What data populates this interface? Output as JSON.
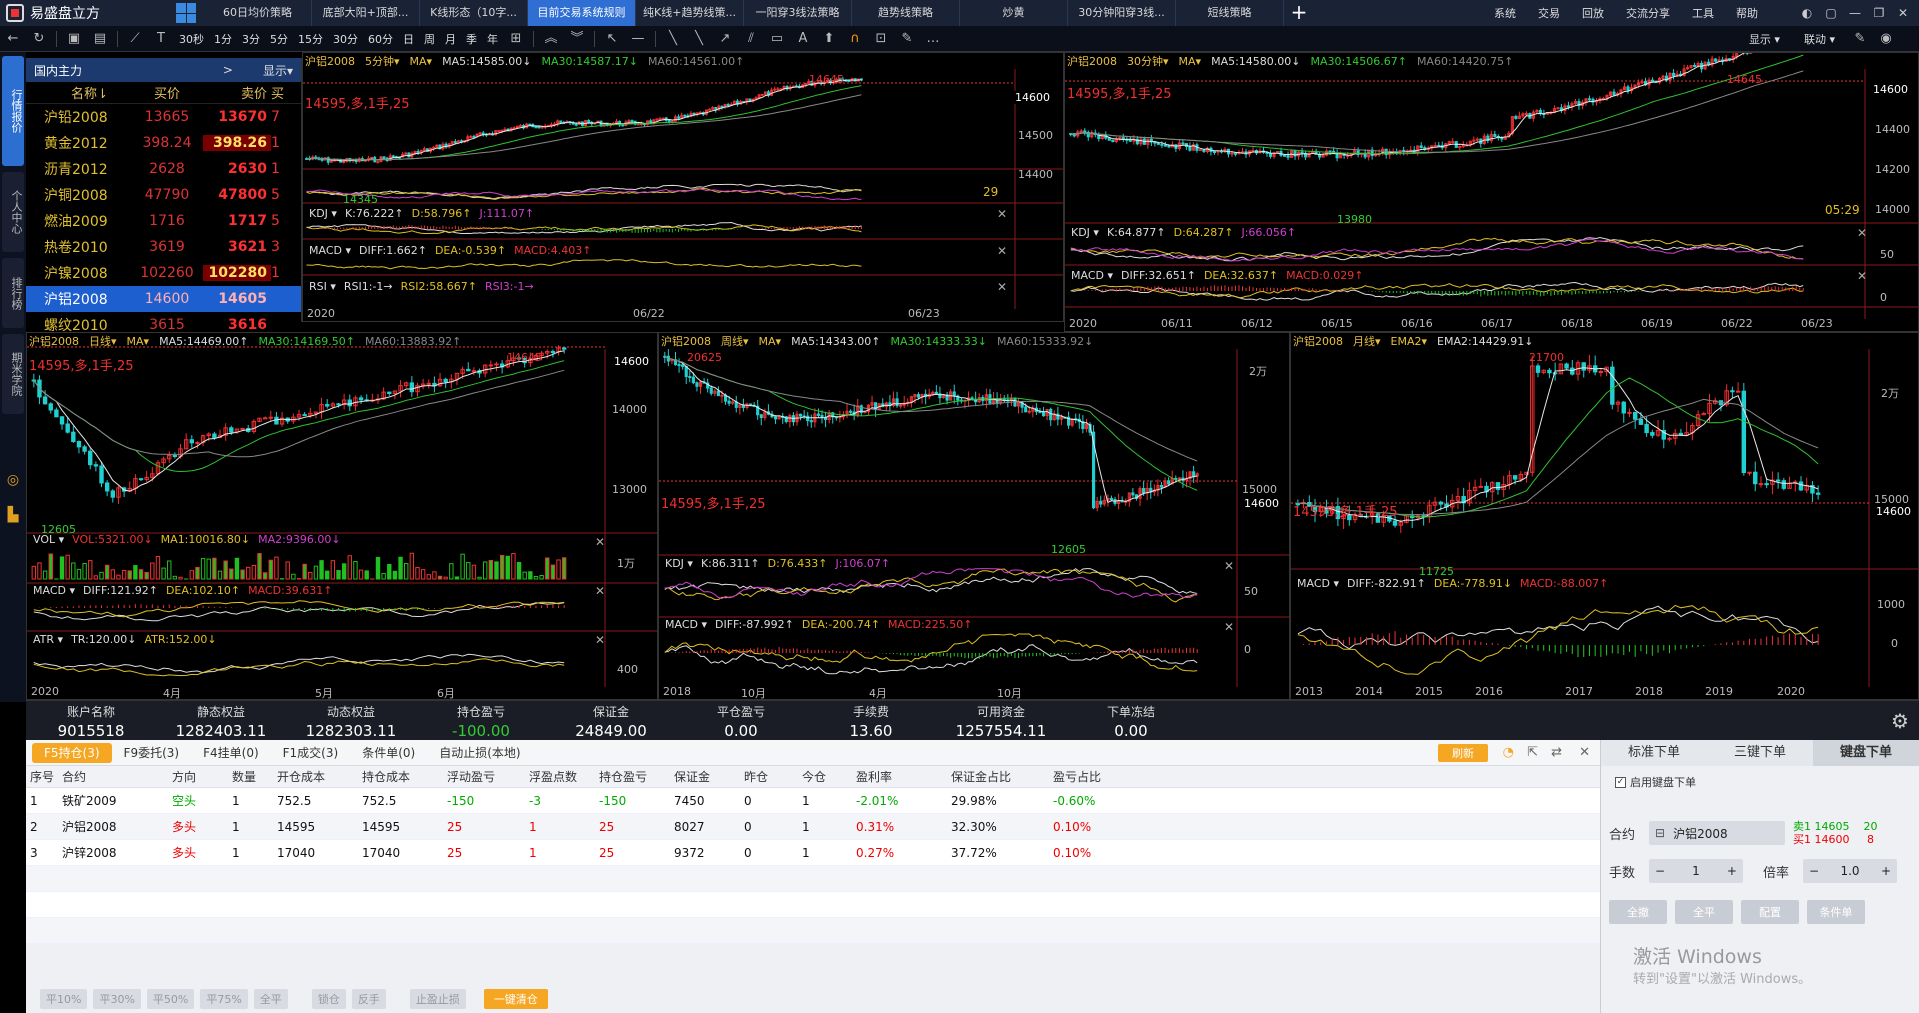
{
  "app": {
    "title": "易盛盘立方"
  },
  "strategy_tabs": [
    "60日均价策略",
    "底部大阳+顶部...",
    "K线形态（10字...",
    "目前交易系统规则",
    "纯K线+趋势线策...",
    "一阳穿3线法策略",
    "趋势线策略",
    "炒黄",
    "30分钟阳穿3线...",
    "短线策略"
  ],
  "active_strategy": 3,
  "menus": [
    "系统",
    "交易",
    "回放",
    "交流分享",
    "工具",
    "帮助"
  ],
  "toolbar": {
    "periods": [
      "30秒",
      "1分",
      "3分",
      "5分",
      "15分",
      "30分",
      "60分",
      "日",
      "周",
      "月",
      "季",
      "年"
    ],
    "display": "显示",
    "link": "联动"
  },
  "left_rail": {
    "tabs": [
      "行情报价",
      "个人中心",
      "排行榜",
      "期米学院"
    ]
  },
  "quote_panel": {
    "title": "国内主力",
    "arrow": ">",
    "display": "显示",
    "columns": {
      "name": "名称",
      "bid": "买价",
      "ask": "卖价",
      "extra": "买"
    },
    "rows": [
      {
        "name": "沪铅2008",
        "sup": "M",
        "bid": "13665",
        "ask": "13670",
        "extra": "7"
      },
      {
        "name": "黄金2012",
        "sup": "M",
        "bid": "398.24",
        "ask": "398.26",
        "extra": "1"
      },
      {
        "name": "沥青2012",
        "sup": "M",
        "bid": "2628",
        "ask": "2630",
        "extra": "1"
      },
      {
        "name": "沪铜2008",
        "sup": "M",
        "bid": "47790",
        "ask": "47800",
        "extra": "5"
      },
      {
        "name": "燃油2009",
        "sup": "M",
        "bid": "1716",
        "ask": "1717",
        "extra": "5"
      },
      {
        "name": "热卷2010",
        "sup": "M",
        "bid": "3619",
        "ask": "3621",
        "extra": "3"
      },
      {
        "name": "沪镍2008",
        "sup": "M",
        "bid": "102260",
        "ask": "102280",
        "extra": "1"
      },
      {
        "name": "沪铝2008",
        "sup": "M",
        "bid": "14600",
        "ask": "14605",
        "extra": ""
      },
      {
        "name": "螺纹2010",
        "sup": "M",
        "bid": "3615",
        "ask": "3616",
        "extra": ""
      }
    ]
  },
  "charts": {
    "c5": {
      "sym": "沪铝2008",
      "period": "5分钟",
      "ind": "MA",
      "ma5": "MA5:14585.00↓",
      "ma30": "MA30:14587.17↓",
      "ma60": "MA60:14561.00↑",
      "pos": "14595,多,1手,25",
      "high": "14645",
      "low": "14345",
      "price": "14600",
      "axis": [
        "14500",
        "14400"
      ],
      "count": "29",
      "kdj": {
        "k": "K:76.222↑",
        "d": "D:58.796↑",
        "j": "J:111.07↑"
      },
      "macd": {
        "diff": "DIFF:1.662↑",
        "dea": "DEA:-0.539↑",
        "macd": "MACD:4.403↑"
      },
      "rsi": {
        "r1": "RSI1:-1→",
        "r2": "RSI2:58.667↑",
        "r3": "RSI3:-1→"
      },
      "dates": [
        "2020",
        "06/22",
        "06/23"
      ]
    },
    "c30": {
      "sym": "沪铝2008",
      "period": "30分钟",
      "ind": "MA",
      "ma5": "MA5:14580.00↓",
      "ma30": "MA30:14506.67↑",
      "ma60": "MA60:14420.75↑",
      "pos": "14595,多,1手,25",
      "high": "14645",
      "low": "13980",
      "price": "14600",
      "axis": [
        "14400",
        "14200",
        "14000"
      ],
      "clock": "05:29",
      "kdj": {
        "k": "K:64.877↑",
        "d": "D:64.287↑",
        "j": "J:66.056↑"
      },
      "macd": {
        "diff": "DIFF:32.651↑",
        "dea": "DEA:32.637↑",
        "macd": "MACD:0.029↑"
      },
      "sub_axis": [
        "50",
        "0"
      ],
      "dates": [
        "2020",
        "06/11",
        "06/12",
        "06/15",
        "06/16",
        "06/17",
        "06/18",
        "06/19",
        "06/22",
        "06/23"
      ]
    },
    "day": {
      "sym": "沪铝2008",
      "period": "日线",
      "ind": "MA",
      "ma5": "MA5:14469.00↑",
      "ma30": "MA30:14169.50↑",
      "ma60": "MA60:13883.92↑",
      "pos": "14595,多,1手,25",
      "high": "14645",
      "low": "12605",
      "price": "14600",
      "axis": [
        "14000",
        "13000"
      ],
      "vol": {
        "vol": "VOL:5321.00↓",
        "ma1": "MA1:10016.80↓",
        "ma2": "MA2:9396.00↓"
      },
      "vol_axis": "1万",
      "macd": {
        "diff": "DIFF:121.92↑",
        "dea": "DEA:102.10↑",
        "macd": "MACD:39.631↑"
      },
      "atr": {
        "tr": "TR:120.00↓",
        "atr": "ATR:152.00↓"
      },
      "atr_axis": "400",
      "dates": [
        "2020",
        "4月",
        "5月",
        "6月"
      ]
    },
    "week": {
      "sym": "沪铝2008",
      "period": "周线",
      "ind": "MA",
      "ma5": "MA5:14343.00↑",
      "ma30": "MA30:14333.33↓",
      "ma60": "MA60:15333.92↓",
      "pos": "14595,多,1手,25",
      "high": "20625",
      "low": "12605",
      "price": "14600",
      "axis": [
        "2万",
        "15000"
      ],
      "kdj": {
        "k": "K:86.311↑",
        "d": "D:76.433↑",
        "j": "J:106.07↑"
      },
      "kdj_axis": "50",
      "macd": {
        "diff": "DIFF:-87.992↑",
        "dea": "DEA:-200.74↑",
        "macd": "MACD:225.50↑"
      },
      "macd_axis": "0",
      "dates": [
        "2018",
        "10月",
        "4月",
        "10月"
      ]
    },
    "month": {
      "sym": "沪铝2008",
      "period": "月线",
      "ind": "EMA2",
      "ema": "EMA2:14429.91↓",
      "pos": "14595,多,1手,25",
      "high": "21700",
      "low": "11725",
      "price": "14600",
      "axis": [
        "2万",
        "15000"
      ],
      "macd": {
        "diff": "DIFF:-822.91↑",
        "dea": "DEA:-778.91↓",
        "macd": "MACD:-88.007↑"
      },
      "macd_axis": [
        "1000",
        "0"
      ],
      "dates": [
        "2013",
        "2014",
        "2015",
        "2016",
        "2017",
        "2018",
        "2019",
        "2020"
      ]
    }
  },
  "account": [
    {
      "label": "账户名称",
      "value": "9015518"
    },
    {
      "label": "静态权益",
      "value": "1282403.11"
    },
    {
      "label": "动态权益",
      "value": "1282303.11"
    },
    {
      "label": "持仓盈亏",
      "value": "-100.00"
    },
    {
      "label": "保证金",
      "value": "24849.00"
    },
    {
      "label": "平仓盈亏",
      "value": "0.00"
    },
    {
      "label": "手续费",
      "value": "13.60"
    },
    {
      "label": "可用资金",
      "value": "1257554.11"
    },
    {
      "label": "下单冻结",
      "value": "0.00"
    }
  ],
  "positions": {
    "tabs": [
      "F5持仓(3)",
      "F9委托(3)",
      "F4挂单(0)",
      "F1成交(3)",
      "条件单(0)",
      "自动止损(本地)"
    ],
    "refresh": "刷新",
    "columns": [
      "序号",
      "合约",
      "方向",
      "数量",
      "开仓成本",
      "持仓成本",
      "浮动盈亏",
      "浮盈点数",
      "持仓盈亏",
      "保证金",
      "昨仓",
      "今仓",
      "盈利率",
      "保证金占比",
      "盈亏占比"
    ],
    "rows": [
      [
        "1",
        "铁矿2009",
        "空头",
        "1",
        "752.5",
        "752.5",
        "-150",
        "-3",
        "-150",
        "7450",
        "0",
        "1",
        "-2.01%",
        "29.98%",
        "-0.60%"
      ],
      [
        "2",
        "沪铝2008",
        "多头",
        "1",
        "14595",
        "14595",
        "25",
        "1",
        "25",
        "8027",
        "0",
        "1",
        "0.31%",
        "32.30%",
        "0.10%"
      ],
      [
        "3",
        "沪锌2008",
        "多头",
        "1",
        "17040",
        "17040",
        "25",
        "1",
        "25",
        "9372",
        "0",
        "1",
        "0.27%",
        "37.72%",
        "0.10%"
      ]
    ],
    "buttons": [
      "平10%",
      "平30%",
      "平50%",
      "平75%",
      "全平",
      "锁仓",
      "反手",
      "止盈止损",
      "一键清仓"
    ]
  },
  "order": {
    "tabs": [
      "标准下单",
      "三键下单",
      "键盘下单"
    ],
    "enable": "启用键盘下单",
    "contract_label": "合约",
    "contract": "沪铝2008",
    "ask_label": "卖1",
    "ask": "14605",
    "ask_qty": "20",
    "bid_label": "买1",
    "bid": "14600",
    "bid_qty": "8",
    "qty_label": "手数",
    "qty": "1",
    "mult_label": "倍率",
    "mult": "1.0",
    "actions": [
      "全撤",
      "全平",
      "配置",
      "条件单"
    ],
    "watermark": "激活 Windows",
    "watermark2": "转到\"设置\"以激活 Windows。"
  }
}
